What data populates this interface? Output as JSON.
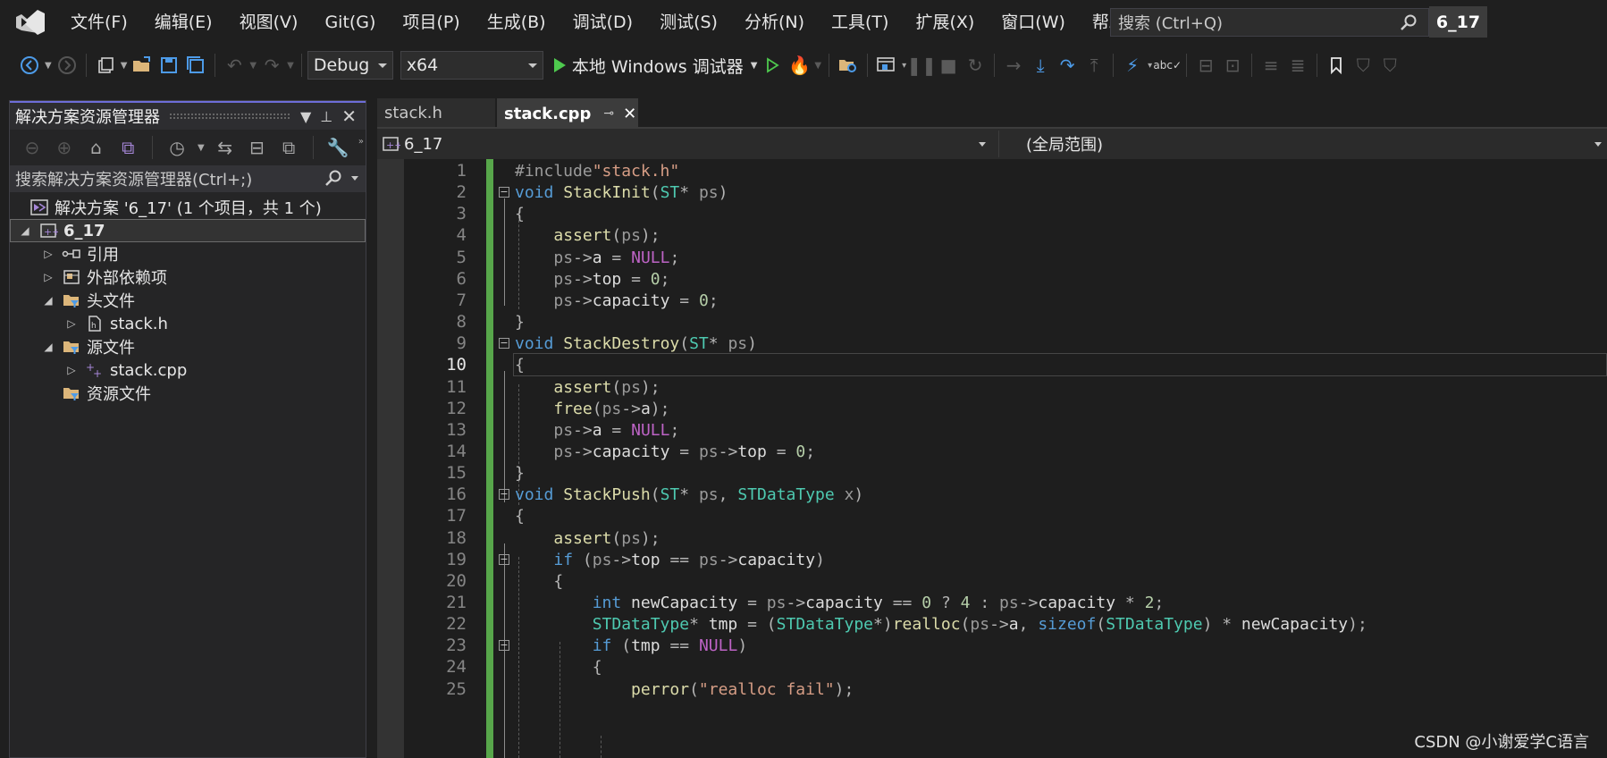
{
  "menu": {
    "items": [
      "文件(F)",
      "编辑(E)",
      "视图(V)",
      "Git(G)",
      "项目(P)",
      "生成(B)",
      "调试(D)",
      "测试(S)",
      "分析(N)",
      "工具(T)",
      "扩展(X)",
      "窗口(W)",
      "帮助(H)"
    ],
    "search_placeholder": "搜索 (Ctrl+Q)",
    "solution_name": "6_17"
  },
  "toolbar": {
    "configuration": "Debug",
    "platform": "x64",
    "run_target": "本地 Windows 调试器"
  },
  "explorer": {
    "title": "解决方案资源管理器",
    "search_placeholder": "搜索解决方案资源管理器(Ctrl+;)",
    "tree": [
      {
        "label": "解决方案 '6_17' (1 个项目，共 1 个)",
        "icon": "solution-icon",
        "expander": "",
        "level": 0
      },
      {
        "label": "6_17",
        "icon": "project-icon",
        "expander": "◢",
        "level": 1
      },
      {
        "label": "引用",
        "icon": "references-icon",
        "expander": "▷",
        "level": 2
      },
      {
        "label": "外部依赖项",
        "icon": "external-deps-icon",
        "expander": "▷",
        "level": 2
      },
      {
        "label": "头文件",
        "icon": "folder-filter-icon",
        "expander": "◢",
        "level": 2
      },
      {
        "label": "stack.h",
        "icon": "header-file-icon",
        "expander": "▷",
        "level": 3
      },
      {
        "label": "源文件",
        "icon": "folder-filter-icon",
        "expander": "◢",
        "level": 2
      },
      {
        "label": "stack.cpp",
        "icon": "cpp-file-icon",
        "expander": "▷",
        "level": 3
      },
      {
        "label": "资源文件",
        "icon": "folder-filter-icon",
        "expander": "",
        "level": 2
      }
    ]
  },
  "editor": {
    "tabs": [
      {
        "label": "stack.h",
        "active": false
      },
      {
        "label": "stack.cpp",
        "active": true
      }
    ],
    "nav_project": "6_17",
    "nav_scope": "(全局范围)",
    "current_line": 10,
    "lines": [
      {
        "n": "1",
        "code": "#include\"stack.h\""
      },
      {
        "n": "2",
        "code": "void StackInit(ST* ps)"
      },
      {
        "n": "3",
        "code": "{"
      },
      {
        "n": "4",
        "code": "    assert(ps);"
      },
      {
        "n": "5",
        "code": "    ps->a = NULL;"
      },
      {
        "n": "6",
        "code": "    ps->top = 0;"
      },
      {
        "n": "7",
        "code": "    ps->capacity = 0;"
      },
      {
        "n": "8",
        "code": "}"
      },
      {
        "n": "9",
        "code": "void StackDestroy(ST* ps)"
      },
      {
        "n": "10",
        "code": "{"
      },
      {
        "n": "11",
        "code": "    assert(ps);"
      },
      {
        "n": "12",
        "code": "    free(ps->a);"
      },
      {
        "n": "13",
        "code": "    ps->a = NULL;"
      },
      {
        "n": "14",
        "code": "    ps->capacity = ps->top = 0;"
      },
      {
        "n": "15",
        "code": "}"
      },
      {
        "n": "16",
        "code": "void StackPush(ST* ps, STDataType x)"
      },
      {
        "n": "17",
        "code": "{"
      },
      {
        "n": "18",
        "code": "    assert(ps);"
      },
      {
        "n": "19",
        "code": "    if (ps->top == ps->capacity)"
      },
      {
        "n": "20",
        "code": "    {"
      },
      {
        "n": "21",
        "code": "        int newCapacity = ps->capacity == 0 ? 4 : ps->capacity * 2;"
      },
      {
        "n": "22",
        "code": "        STDataType* tmp = (STDataType*)realloc(ps->a, sizeof(STDataType) * newCapacity);"
      },
      {
        "n": "23",
        "code": "        if (tmp == NULL)"
      },
      {
        "n": "24",
        "code": "        {"
      },
      {
        "n": "25",
        "code": "            perror(\"realloc fail\");"
      }
    ]
  },
  "watermark": "CSDN @小谢爱学C语言"
}
